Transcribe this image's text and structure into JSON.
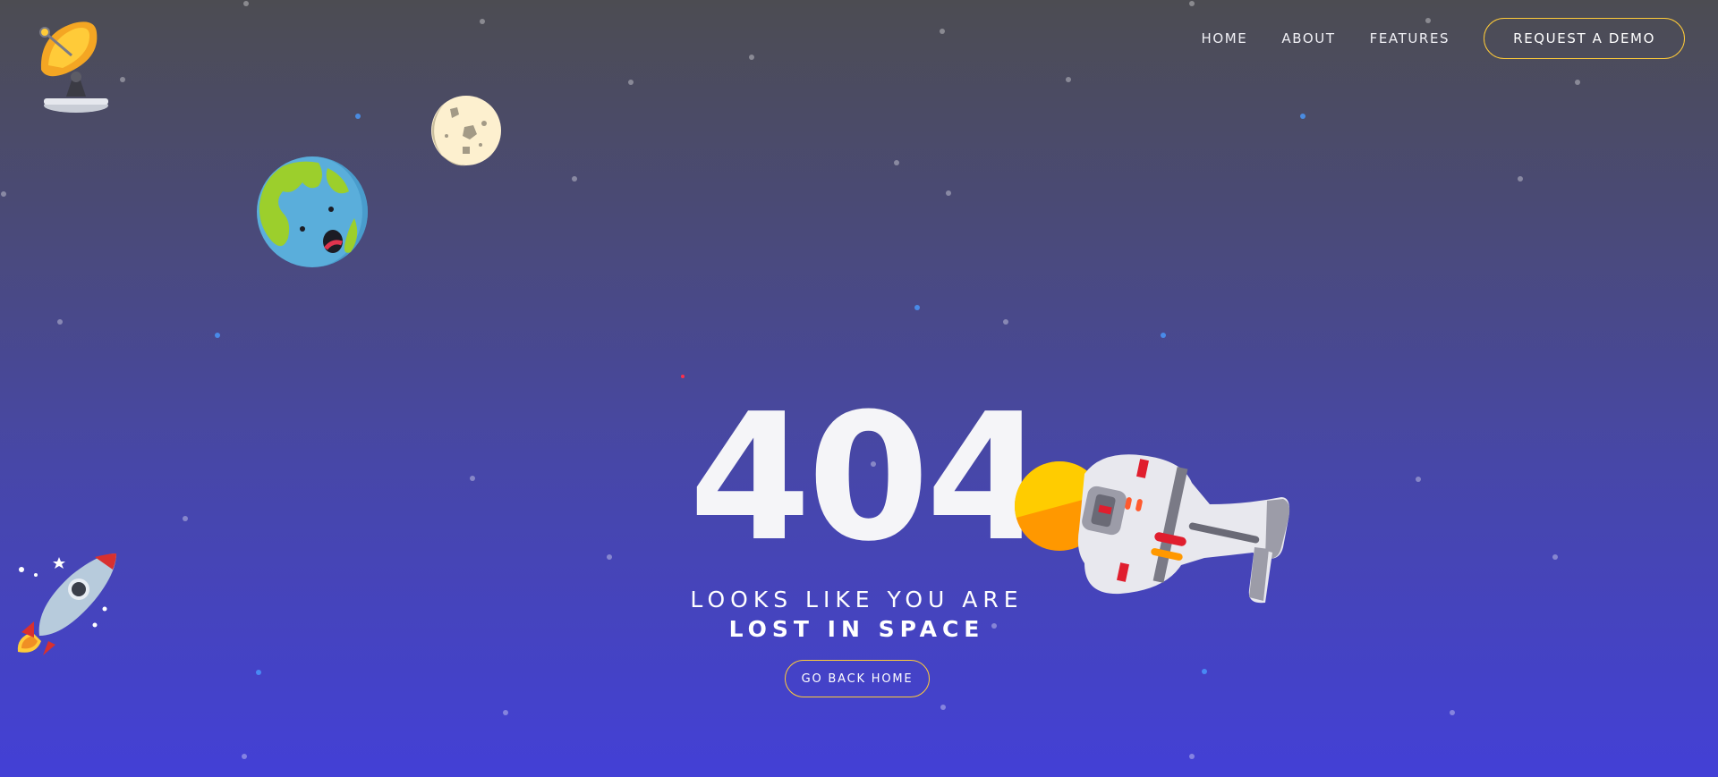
{
  "nav": {
    "items": [
      "HOME",
      "ABOUT",
      "FEATURES"
    ],
    "cta": "REQUEST A DEMO"
  },
  "error": {
    "code": "404",
    "line1": "LOOKS LIKE YOU ARE",
    "line2": "LOST IN SPACE",
    "button": "GO BACK HOME"
  },
  "illustrations": {
    "logo": "satellite-dish-icon",
    "earth": "earth-planet-icon",
    "moon": "moon-icon",
    "rocket": "rocket-icon",
    "astronaut": "astronaut-icon"
  },
  "colors": {
    "accent": "#ffcb39",
    "background_top": "#4c4c52",
    "background_bottom": "#4340d6",
    "text": "#ffffff"
  }
}
